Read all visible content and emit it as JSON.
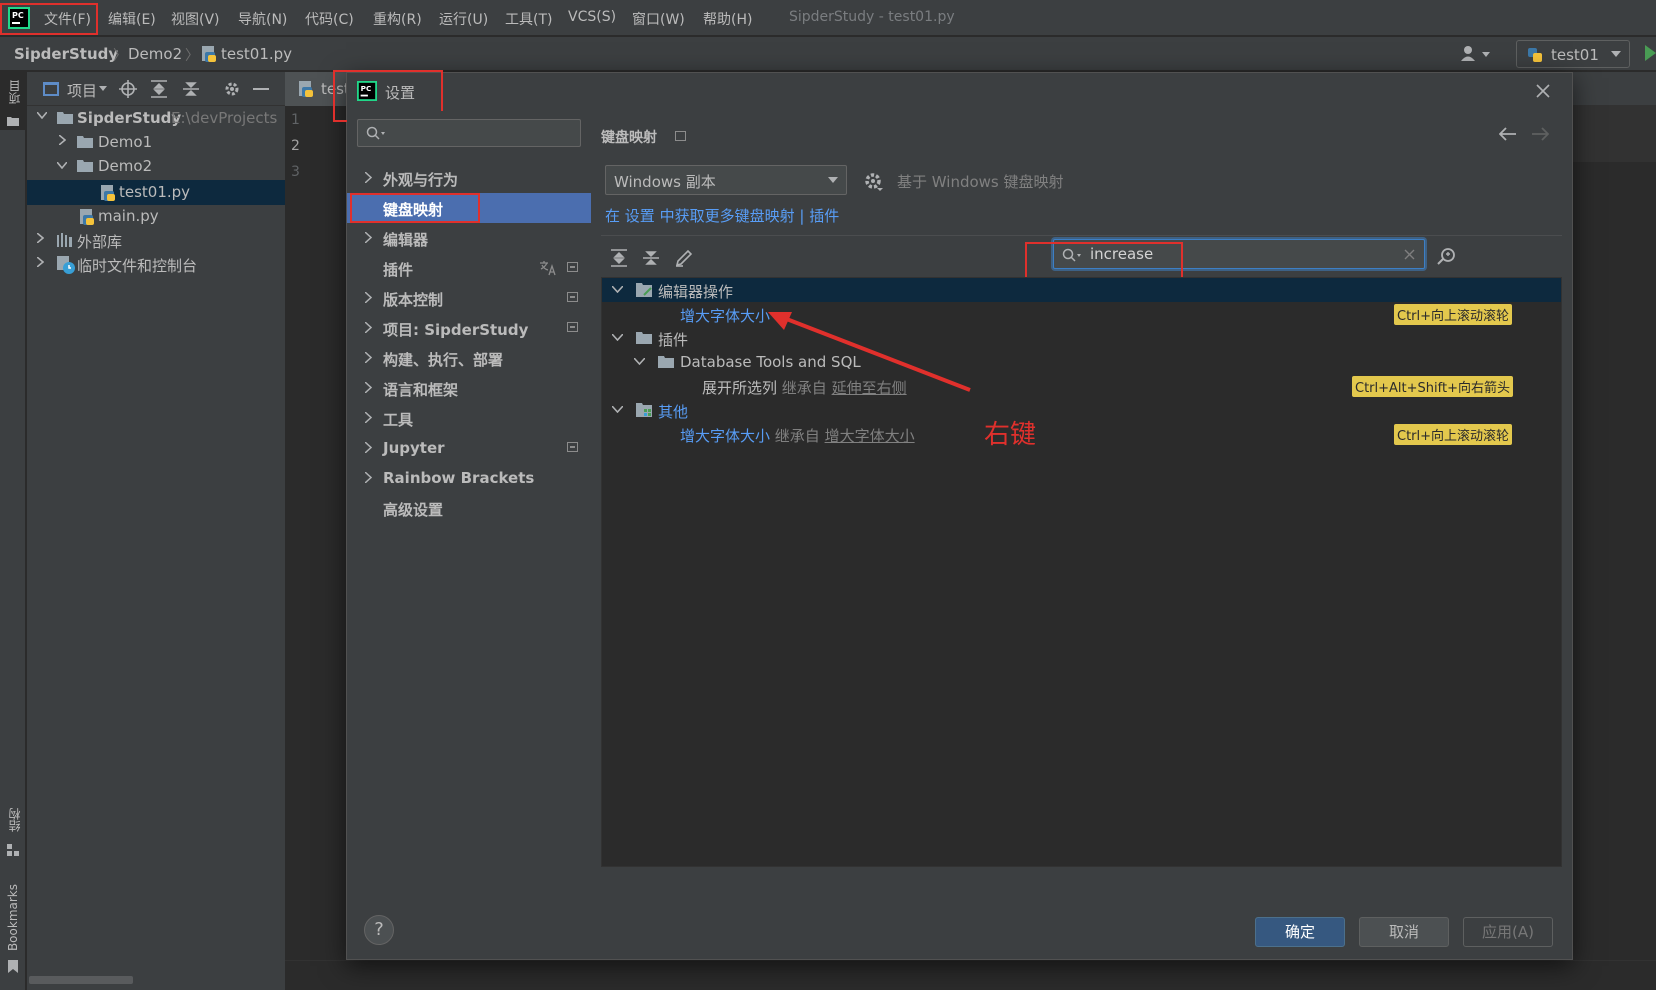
{
  "app": {
    "title": "SipderStudy - test01.py",
    "menu": [
      "文件(F)",
      "编辑(E)",
      "视图(V)",
      "导航(N)",
      "代码(C)",
      "重构(R)",
      "运行(U)",
      "工具(T)",
      "VCS(S)",
      "窗口(W)",
      "帮助(H)"
    ]
  },
  "breadcrumb": [
    "SipderStudy",
    "Demo2",
    "test01.py"
  ],
  "run_config": "test01",
  "left_strip": {
    "project": "项目",
    "structure": "结构",
    "bookmarks": "Bookmarks"
  },
  "project_panel": {
    "toolbar_label": "项目",
    "tree": [
      {
        "label": "SipderStudy",
        "suffix": "E:\\devProjects",
        "kind": "folder"
      },
      {
        "label": "Demo1",
        "kind": "folder"
      },
      {
        "label": "Demo2",
        "kind": "folder"
      },
      {
        "label": "test01.py",
        "kind": "python-file",
        "selected": true
      },
      {
        "label": "main.py",
        "kind": "python-file"
      },
      {
        "label": "外部库",
        "kind": "library"
      },
      {
        "label": "临时文件和控制台",
        "kind": "scratch"
      }
    ]
  },
  "editor": {
    "tab_label": "test",
    "line_numbers": [
      "1",
      "2",
      "3"
    ]
  },
  "dialog": {
    "title": "设置",
    "search_placeholder": "",
    "nav": [
      {
        "label": "外观与行为",
        "has_children": true
      },
      {
        "label": "键盘映射",
        "selected": true
      },
      {
        "label": "编辑器",
        "has_children": true
      },
      {
        "label": "插件",
        "badges": 2
      },
      {
        "label": "版本控制",
        "has_children": true,
        "badges": 1
      },
      {
        "label": "项目: SipderStudy",
        "has_children": true,
        "badges": 1
      },
      {
        "label": "构建、执行、部署",
        "has_children": true
      },
      {
        "label": "语言和框架",
        "has_children": true
      },
      {
        "label": "工具",
        "has_children": true
      },
      {
        "label": "Jupyter",
        "has_children": true,
        "badges": 1
      },
      {
        "label": "Rainbow Brackets",
        "has_children": true
      },
      {
        "label": "高级设置"
      }
    ],
    "keymap": {
      "heading": "键盘映射",
      "scheme": "Windows 副本",
      "based_on": "基于 Windows 键盘映射",
      "more_link": {
        "prefix": "在",
        "settings": "设置",
        "middle": "中获取更多键盘映射",
        "sep": "|",
        "plugins": "插件"
      },
      "search_value": "increase",
      "results": [
        {
          "level": 0,
          "label": "编辑器操作",
          "kind": "group",
          "icon": "editor-actions-icon"
        },
        {
          "level": 1,
          "label": "增大字体大小",
          "kind": "action-link",
          "shortcut": "Ctrl+向上滚动滚轮"
        },
        {
          "level": 0,
          "label": "插件",
          "kind": "group",
          "icon": "folder-icon"
        },
        {
          "level": 1,
          "label": "Database Tools and SQL",
          "kind": "group",
          "icon": "folder-icon"
        },
        {
          "level": 2,
          "label": "展开所选列",
          "kind": "action",
          "inherit_prefix": "继承自",
          "inherit": "延伸至右侧",
          "shortcut": "Ctrl+Alt+Shift+向右箭头"
        },
        {
          "level": 0,
          "label": "其他",
          "kind": "group-link",
          "icon": "other-icon"
        },
        {
          "level": 1,
          "label": "增大字体大小",
          "kind": "action-link",
          "inherit_prefix": "继承自",
          "inherit": "增大字体大小",
          "shortcut": "Ctrl+向上滚动滚轮"
        }
      ],
      "annotation": "右键"
    },
    "buttons": {
      "ok": "确定",
      "cancel": "取消",
      "apply": "应用(A)"
    },
    "help": "?"
  }
}
